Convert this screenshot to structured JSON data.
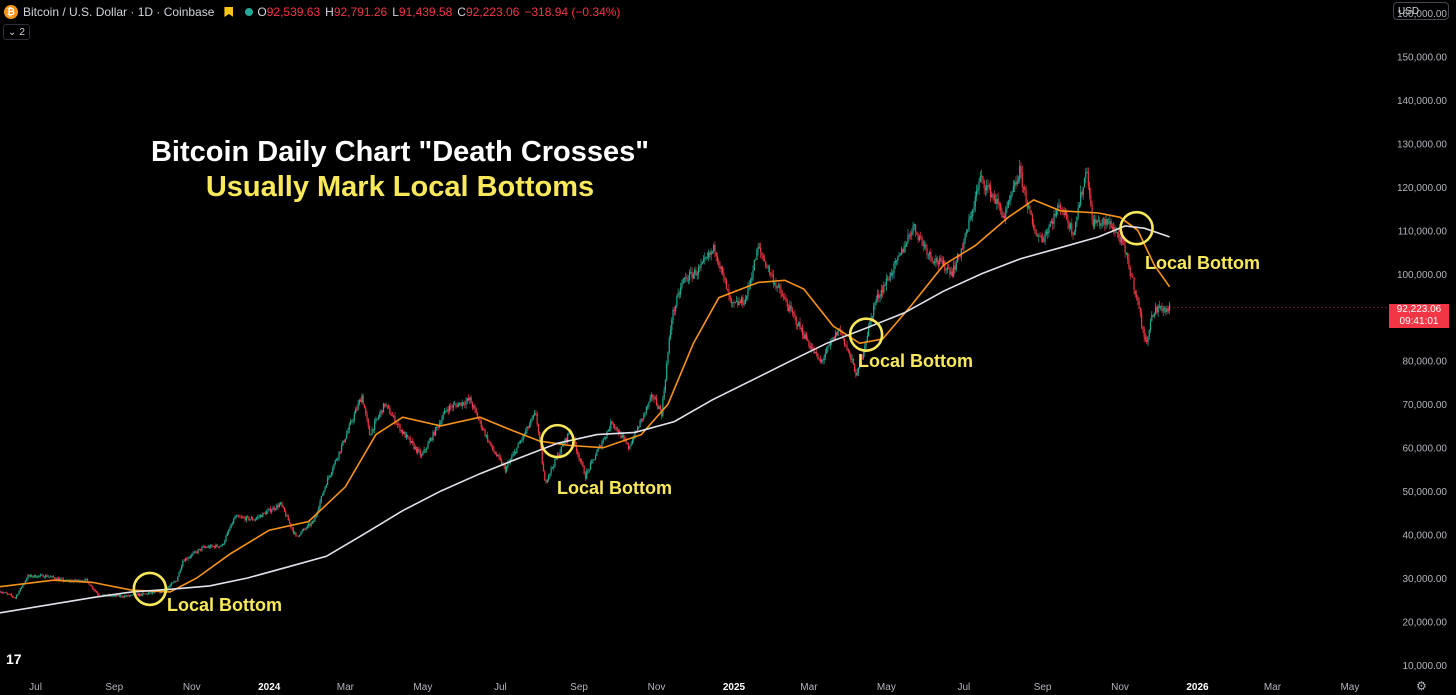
{
  "header": {
    "symbol": "Bitcoin / U.S. Dollar · 1D · Coinbase",
    "logo_glyph": "₿",
    "open_label": "O",
    "open": "92,539.63",
    "high_label": "H",
    "high": "92,791.26",
    "low_label": "L",
    "low": "91,439.58",
    "close_label": "C",
    "close": "92,223.06",
    "change": "−318.94 (−0.34%)",
    "indicator_toggle": "2",
    "indicator_icon": "chevron-down-icon"
  },
  "currency": "USD",
  "price_tag": {
    "price": "92,223.06",
    "countdown": "09:41:01"
  },
  "annotations": {
    "title_line1": "Bitcoin Daily Chart \"Death Crosses\"",
    "title_line2": "Usually Mark Local Bottoms",
    "local_bottoms": [
      "Local Bottom",
      "Local Bottom",
      "Local Bottom",
      "Local Bottom"
    ]
  },
  "logo_text": "17",
  "colors": {
    "up": "#22ab94",
    "down": "#f23645",
    "ma_fast": "#f7931a",
    "ma_slow": "#e0e3eb",
    "highlight": "#f9e95a",
    "background": "#000000"
  },
  "chart_data": {
    "type": "candlestick",
    "title": "Bitcoin / U.S. Dollar · 1D · Coinbase",
    "y_axis": {
      "ticks": [
        10000,
        20000,
        30000,
        40000,
        50000,
        60000,
        70000,
        80000,
        90000,
        100000,
        110000,
        120000,
        130000,
        140000,
        150000,
        160000
      ],
      "tick_labels": [
        "10,000.00",
        "20,000.00",
        "30,000.00",
        "40,000.00",
        "50,000.00",
        "60,000.00",
        "70,000.00",
        "80,000.00",
        "90,000.00",
        "100,000.00",
        "110,000.00",
        "120,000.00",
        "130,000.00",
        "140,000.00",
        "150,000.00",
        "160,000.00"
      ],
      "ylim": [
        7000,
        163000
      ]
    },
    "x_axis": {
      "xlim": [
        "2023-06-03",
        "2026-05-31"
      ],
      "ticks": [
        "2023-07-01",
        "2023-09-01",
        "2023-11-01",
        "2024-01-01",
        "2024-03-01",
        "2024-05-01",
        "2024-07-01",
        "2024-09-01",
        "2024-11-01",
        "2025-01-01",
        "2025-03-01",
        "2025-05-01",
        "2025-07-01",
        "2025-09-01",
        "2025-11-01",
        "2026-01-01",
        "2026-03-01",
        "2026-05-01"
      ],
      "tick_labels": [
        "Jul",
        "Sep",
        "Nov",
        "2024",
        "Mar",
        "May",
        "Jul",
        "Sep",
        "Nov",
        "2025",
        "Mar",
        "May",
        "Jul",
        "Sep",
        "Nov",
        "2026",
        "Mar",
        "May"
      ],
      "bold_ticks": [
        "2024",
        "2025",
        "2026"
      ]
    },
    "price_series": [
      [
        "2023-06-03",
        27000
      ],
      [
        "2023-06-15",
        25500
      ],
      [
        "2023-06-25",
        30400
      ],
      [
        "2023-07-10",
        30500
      ],
      [
        "2023-07-25",
        29300
      ],
      [
        "2023-08-10",
        29500
      ],
      [
        "2023-08-20",
        26000
      ],
      [
        "2023-09-10",
        25800
      ],
      [
        "2023-09-25",
        26300
      ],
      [
        "2023-10-10",
        27000
      ],
      [
        "2023-10-20",
        29500
      ],
      [
        "2023-10-25",
        34000
      ],
      [
        "2023-11-10",
        37000
      ],
      [
        "2023-11-25",
        37500
      ],
      [
        "2023-12-05",
        44000
      ],
      [
        "2023-12-20",
        43500
      ],
      [
        "2024-01-10",
        47000
      ],
      [
        "2024-01-22",
        39500
      ],
      [
        "2024-02-05",
        43000
      ],
      [
        "2024-02-15",
        52000
      ],
      [
        "2024-02-28",
        61000
      ],
      [
        "2024-03-14",
        72000
      ],
      [
        "2024-03-20",
        63000
      ],
      [
        "2024-04-01",
        70000
      ],
      [
        "2024-04-15",
        63500
      ],
      [
        "2024-04-30",
        58000
      ],
      [
        "2024-05-20",
        69000
      ],
      [
        "2024-06-07",
        71000
      ],
      [
        "2024-06-24",
        60000
      ],
      [
        "2024-07-05",
        55000
      ],
      [
        "2024-07-29",
        68000
      ],
      [
        "2024-08-05",
        52000
      ],
      [
        "2024-08-25",
        64000
      ],
      [
        "2024-09-06",
        53500
      ],
      [
        "2024-09-27",
        66000
      ],
      [
        "2024-10-10",
        60000
      ],
      [
        "2024-10-29",
        72000
      ],
      [
        "2024-11-05",
        68000
      ],
      [
        "2024-11-13",
        90000
      ],
      [
        "2024-11-22",
        98500
      ],
      [
        "2024-12-05",
        101000
      ],
      [
        "2024-12-17",
        106000
      ],
      [
        "2024-12-30",
        92500
      ],
      [
        "2025-01-10",
        94000
      ],
      [
        "2025-01-20",
        106000
      ],
      [
        "2025-02-03",
        97500
      ],
      [
        "2025-02-25",
        86000
      ],
      [
        "2025-03-10",
        79500
      ],
      [
        "2025-03-25",
        87500
      ],
      [
        "2025-04-08",
        76500
      ],
      [
        "2025-04-22",
        93500
      ],
      [
        "2025-05-10",
        103000
      ],
      [
        "2025-05-22",
        111000
      ],
      [
        "2025-06-05",
        104000
      ],
      [
        "2025-06-22",
        100500
      ],
      [
        "2025-07-01",
        107000
      ],
      [
        "2025-07-14",
        122000
      ],
      [
        "2025-07-24",
        118000
      ],
      [
        "2025-08-02",
        113000
      ],
      [
        "2025-08-14",
        123500
      ],
      [
        "2025-08-25",
        110000
      ],
      [
        "2025-09-01",
        108000
      ],
      [
        "2025-09-15",
        116000
      ],
      [
        "2025-09-25",
        109500
      ],
      [
        "2025-10-06",
        124500
      ],
      [
        "2025-10-10",
        112000
      ],
      [
        "2025-10-25",
        111500
      ],
      [
        "2025-11-03",
        107000
      ],
      [
        "2025-11-14",
        95000
      ],
      [
        "2025-11-21",
        84000
      ],
      [
        "2025-11-27",
        91000
      ],
      [
        "2025-12-03",
        92500
      ],
      [
        "2025-12-07",
        91500
      ],
      [
        "2025-12-10",
        92223
      ]
    ],
    "series": [
      {
        "color": "#f7931a",
        "values": [
          [
            "2023-06-03",
            28000
          ],
          [
            "2023-07-15",
            29500
          ],
          [
            "2023-08-15",
            29000
          ],
          [
            "2023-09-15",
            27200
          ],
          [
            "2023-10-15",
            26800
          ],
          [
            "2023-11-05",
            30000
          ],
          [
            "2023-12-01",
            35500
          ],
          [
            "2024-01-01",
            41000
          ],
          [
            "2024-02-01",
            43000
          ],
          [
            "2024-03-01",
            51000
          ],
          [
            "2024-03-25",
            63000
          ],
          [
            "2024-04-15",
            67000
          ],
          [
            "2024-05-15",
            65000
          ],
          [
            "2024-06-15",
            67000
          ],
          [
            "2024-07-10",
            64000
          ],
          [
            "2024-08-01",
            61500
          ],
          [
            "2024-08-25",
            60500
          ],
          [
            "2024-09-20",
            60000
          ],
          [
            "2024-10-20",
            63000
          ],
          [
            "2024-11-10",
            70000
          ],
          [
            "2024-11-30",
            84000
          ],
          [
            "2024-12-20",
            94500
          ],
          [
            "2025-01-20",
            98000
          ],
          [
            "2025-02-10",
            98500
          ],
          [
            "2025-02-25",
            96500
          ],
          [
            "2025-03-20",
            88000
          ],
          [
            "2025-04-10",
            84000
          ],
          [
            "2025-04-28",
            85000
          ],
          [
            "2025-05-20",
            92500
          ],
          [
            "2025-06-15",
            102000
          ],
          [
            "2025-07-10",
            106500
          ],
          [
            "2025-08-05",
            113000
          ],
          [
            "2025-08-25",
            117000
          ],
          [
            "2025-09-15",
            114500
          ],
          [
            "2025-10-15",
            114000
          ],
          [
            "2025-11-01",
            113000
          ],
          [
            "2025-11-15",
            110000
          ],
          [
            "2025-11-28",
            102000
          ],
          [
            "2025-12-10",
            97000
          ]
        ]
      },
      {
        "color": "#e0e3eb",
        "values": [
          [
            "2023-06-03",
            22000
          ],
          [
            "2023-07-15",
            24000
          ],
          [
            "2023-08-15",
            25500
          ],
          [
            "2023-09-15",
            26800
          ],
          [
            "2023-10-15",
            27400
          ],
          [
            "2023-11-15",
            28200
          ],
          [
            "2023-12-15",
            30000
          ],
          [
            "2024-01-15",
            32500
          ],
          [
            "2024-02-15",
            35000
          ],
          [
            "2024-03-15",
            40000
          ],
          [
            "2024-04-15",
            45500
          ],
          [
            "2024-05-15",
            50000
          ],
          [
            "2024-06-15",
            54000
          ],
          [
            "2024-07-15",
            57500
          ],
          [
            "2024-08-15",
            61000
          ],
          [
            "2024-09-15",
            63000
          ],
          [
            "2024-10-15",
            63500
          ],
          [
            "2024-11-15",
            66000
          ],
          [
            "2024-12-15",
            71000
          ],
          [
            "2025-01-15",
            75500
          ],
          [
            "2025-02-15",
            80000
          ],
          [
            "2025-03-15",
            84000
          ],
          [
            "2025-04-15",
            87500
          ],
          [
            "2025-05-15",
            91000
          ],
          [
            "2025-06-15",
            96000
          ],
          [
            "2025-07-15",
            100000
          ],
          [
            "2025-08-15",
            103500
          ],
          [
            "2025-09-15",
            106000
          ],
          [
            "2025-10-15",
            108500
          ],
          [
            "2025-11-05",
            111000
          ],
          [
            "2025-11-20",
            110500
          ],
          [
            "2025-12-10",
            108500
          ]
        ]
      }
    ],
    "markers": [
      {
        "x": "2023-09-29",
        "y": 27500,
        "label": "Local Bottom"
      },
      {
        "x": "2024-08-15",
        "y": 61500,
        "label": "Local Bottom"
      },
      {
        "x": "2025-04-15",
        "y": 86000,
        "label": "Local Bottom"
      },
      {
        "x": "2025-11-14",
        "y": 110500,
        "label": "Local Bottom"
      }
    ],
    "last_price": 92223.06
  }
}
